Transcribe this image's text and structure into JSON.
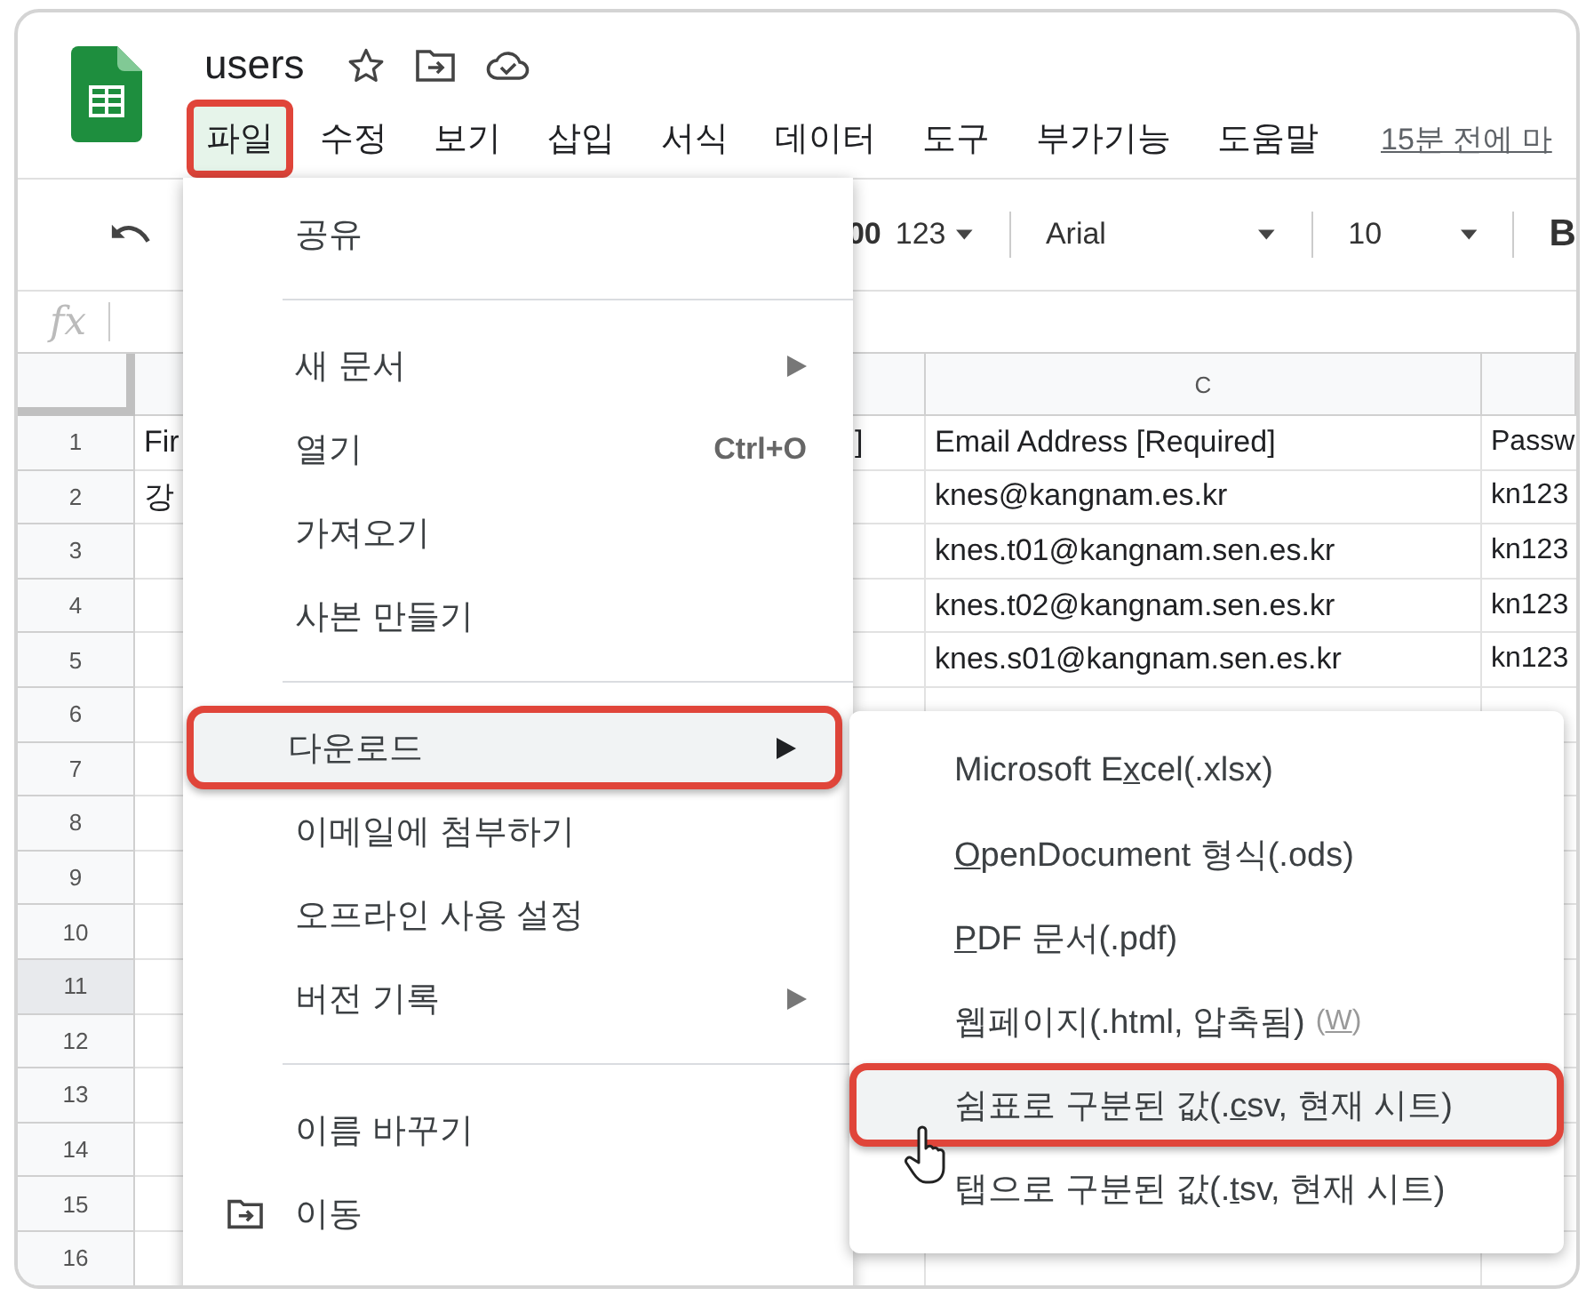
{
  "document": {
    "title": "users",
    "last_edit": "15분 전에 마"
  },
  "menu_bar": [
    {
      "label": "파일",
      "selected": true,
      "highlighted": true
    },
    {
      "label": "수정",
      "selected": false,
      "highlighted": false
    },
    {
      "label": "보기",
      "selected": false,
      "highlighted": false
    },
    {
      "label": "삽입",
      "selected": false,
      "highlighted": false
    },
    {
      "label": "서식",
      "selected": false,
      "highlighted": false
    },
    {
      "label": "데이터",
      "selected": false,
      "highlighted": false
    },
    {
      "label": "도구",
      "selected": false,
      "highlighted": false
    },
    {
      "label": "부가기능",
      "selected": false,
      "highlighted": false
    },
    {
      "label": "도움말",
      "selected": false,
      "highlighted": false
    }
  ],
  "toolbar": {
    "decimal": "00",
    "number_format": "123",
    "font": "Arial",
    "font_size": "10",
    "bold": "B"
  },
  "formula_bar": {
    "label": "fx"
  },
  "sheet": {
    "column_headers": {
      "column_c": "C"
    },
    "rows": [
      {
        "number": "1",
        "selected": false,
        "column_a": "Fir",
        "column_b": "]",
        "column_c": "Email Address [Required]",
        "column_d": "Passw"
      },
      {
        "number": "2",
        "selected": false,
        "column_a": "강",
        "column_c": "knes@kangnam.es.kr",
        "column_d": "kn123"
      },
      {
        "number": "3",
        "selected": false,
        "column_c": "knes.t01@kangnam.sen.es.kr",
        "column_d": "kn123"
      },
      {
        "number": "4",
        "selected": false,
        "column_c": "knes.t02@kangnam.sen.es.kr",
        "column_d": "kn123"
      },
      {
        "number": "5",
        "selected": false,
        "column_c": "knes.s01@kangnam.sen.es.kr",
        "column_d": "kn123"
      },
      {
        "number": "6",
        "selected": false
      },
      {
        "number": "7",
        "selected": false
      },
      {
        "number": "8",
        "selected": false
      },
      {
        "number": "9",
        "selected": false
      },
      {
        "number": "10",
        "selected": false
      },
      {
        "number": "11",
        "selected": true
      },
      {
        "number": "12",
        "selected": false
      },
      {
        "number": "13",
        "selected": false
      },
      {
        "number": "14",
        "selected": false
      },
      {
        "number": "15",
        "selected": false
      },
      {
        "number": "16",
        "selected": false
      }
    ]
  },
  "file_menu": [
    {
      "kind": "item",
      "label": "공유",
      "submenu": false,
      "highlighted": false,
      "has_icon": false
    },
    {
      "kind": "separator"
    },
    {
      "kind": "item",
      "label": "새 문서",
      "submenu": true,
      "highlighted": false,
      "has_icon": false
    },
    {
      "kind": "item",
      "label": "열기",
      "shortcut": "Ctrl+O",
      "submenu": false,
      "highlighted": false,
      "has_icon": false
    },
    {
      "kind": "item",
      "label": "가져오기",
      "submenu": false,
      "highlighted": false,
      "has_icon": false
    },
    {
      "kind": "item",
      "label": "사본 만들기",
      "submenu": false,
      "highlighted": false,
      "has_icon": false
    },
    {
      "kind": "separator"
    },
    {
      "kind": "item",
      "label": "다운로드",
      "submenu": true,
      "highlighted": true,
      "has_icon": false
    },
    {
      "kind": "item",
      "label": "이메일에 첨부하기",
      "submenu": false,
      "highlighted": false,
      "has_icon": false
    },
    {
      "kind": "item",
      "label": "오프라인 사용 설정",
      "submenu": false,
      "highlighted": false,
      "has_icon": false
    },
    {
      "kind": "item",
      "label": "버전 기록",
      "submenu": true,
      "highlighted": false,
      "has_icon": false
    },
    {
      "kind": "separator"
    },
    {
      "kind": "item",
      "label": "이름 바꾸기",
      "submenu": false,
      "highlighted": false,
      "has_icon": false
    },
    {
      "kind": "item",
      "label": "이동",
      "submenu": false,
      "highlighted": false,
      "has_icon": true
    }
  ],
  "download_menu": [
    {
      "before": "Microsoft E",
      "key": "x",
      "after": "cel(.xlsx)",
      "highlighted": false
    },
    {
      "key": "O",
      "after": "penDocument 형식(.ods)",
      "highlighted": false
    },
    {
      "key": "P",
      "after": "DF 문서(.pdf)",
      "highlighted": false
    },
    {
      "before": "웹페이지(.html, 압축됨)",
      "hint": {
        "before": "(",
        "key": "W",
        "after": ")"
      },
      "highlighted": false
    },
    {
      "before": "쉼표로 구분된 값(.",
      "key": "c",
      "after": "sv, 현재 시트)",
      "highlighted": true
    },
    {
      "before": "탭으로 구분된 값(.",
      "key": "t",
      "after": "sv, 현재 시트)",
      "highlighted": false
    }
  ]
}
